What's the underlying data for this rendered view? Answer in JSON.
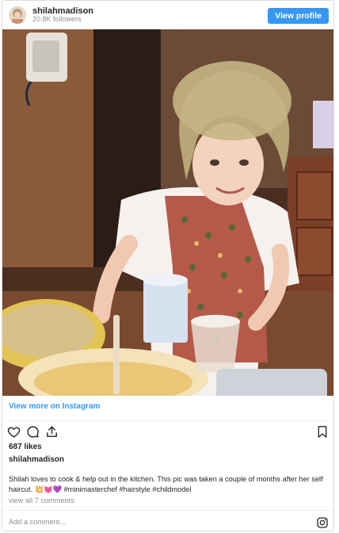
{
  "header": {
    "username": "shilahmadison",
    "followers": "20.8K followers",
    "view_profile_label": "View profile"
  },
  "photo": {
    "description_icon": "photo"
  },
  "view_more_label": "View more on Instagram",
  "actions": {
    "like_icon": "heart-icon",
    "comment_icon": "comment-icon",
    "share_icon": "share-icon",
    "save_icon": "bookmark-icon"
  },
  "likes": "687 likes",
  "caption": {
    "username": "shilahmadison",
    "text": "Shilah loves to cook & help out in the kitchen. This pic was taken a couple of months after her self haircut. 💥💓💜 #minimasterchef #hairstyle #childmodel"
  },
  "view_comments": "view all 7 comments",
  "add_comment_placeholder": "Add a comment...",
  "colors": {
    "accent": "#3897f0",
    "text": "#262626",
    "muted": "#8e8e8e",
    "border": "#dbdbdb"
  }
}
